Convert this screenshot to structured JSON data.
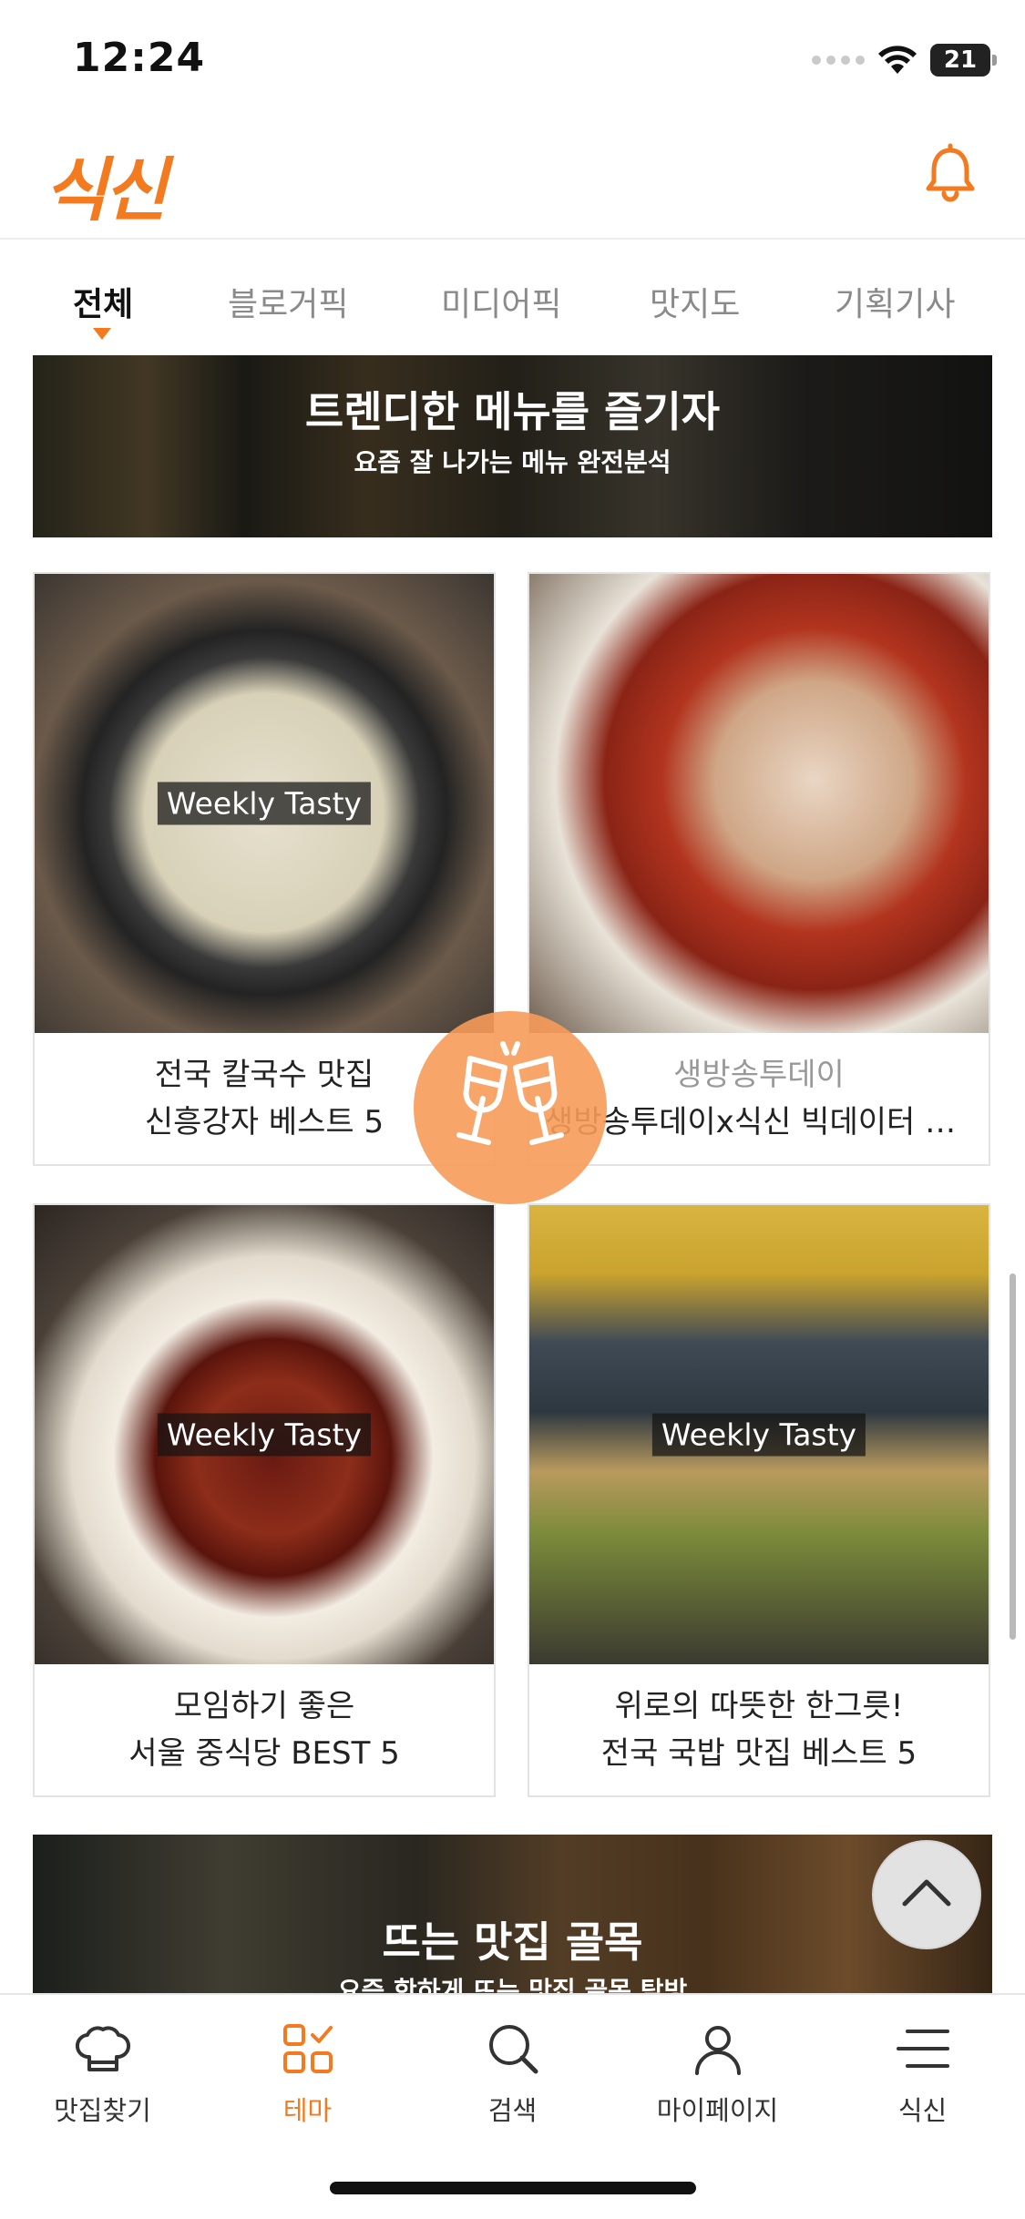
{
  "status_bar": {
    "time": "12:24",
    "battery": "21"
  },
  "header": {
    "logo_text": "식신",
    "bell_icon": "bell-icon",
    "accent_color": "#f47a1f"
  },
  "tabs": [
    {
      "label": "전체",
      "active": true
    },
    {
      "label": "블로거픽",
      "active": false
    },
    {
      "label": "미디어픽",
      "active": false
    },
    {
      "label": "맛지도",
      "active": false
    },
    {
      "label": "기획기사",
      "active": false
    }
  ],
  "banner_top": {
    "title": "트렌디한 메뉴를 즐기자",
    "subtitle": "요즘 잘 나가는 메뉴 완전분석"
  },
  "cards": [
    {
      "badge": "Weekly Tasty",
      "line1": "전국 칼국수 맛집",
      "line2": "신흥강자 베스트 5"
    },
    {
      "badge": "",
      "line1": "생방송투데이",
      "line2": "생방송투데이x식신 빅데이터 맛집"
    },
    {
      "badge": "Weekly Tasty",
      "line1": "모임하기 좋은",
      "line2": "서울 중식당 BEST 5"
    },
    {
      "badge": "Weekly Tasty",
      "line1": "위로의 따뜻한 한그릇!",
      "line2": "전국 국밥 맛집 베스트 5"
    }
  ],
  "banner_bottom": {
    "title": "뜨는 맛집 골목",
    "subtitle": "요즘 핫하게 뜨는 맛집 골목 탐방"
  },
  "float_button": {
    "icon": "cheers-glasses-icon"
  },
  "scroll_top": {
    "icon": "chevron-up-icon"
  },
  "bottom_nav": [
    {
      "label": "맛집찾기",
      "icon": "chef-hat-icon",
      "active": false
    },
    {
      "label": "테마",
      "icon": "theme-grid-icon",
      "active": true
    },
    {
      "label": "검색",
      "icon": "search-icon",
      "active": false
    },
    {
      "label": "마이페이지",
      "icon": "person-icon",
      "active": false
    },
    {
      "label": "식신",
      "icon": "menu-icon",
      "active": false
    }
  ]
}
